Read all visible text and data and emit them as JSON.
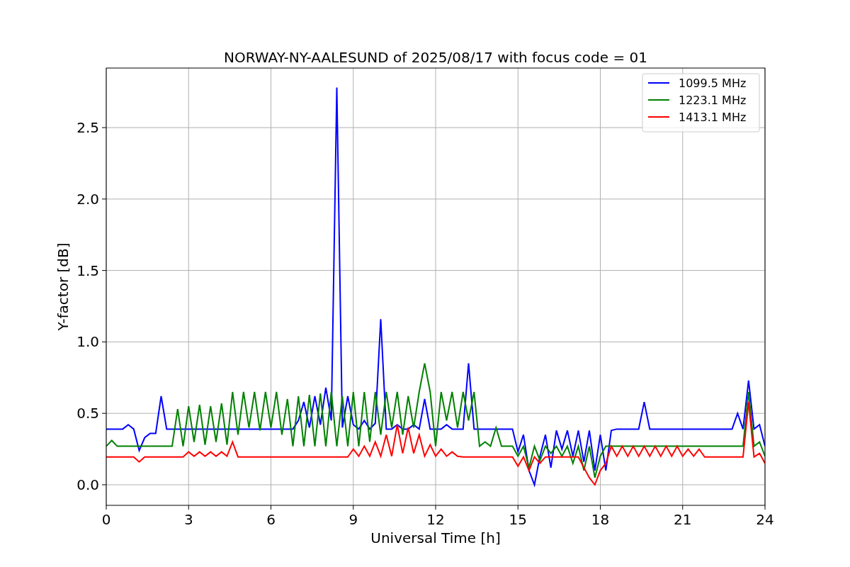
{
  "figure": {
    "chart_data": {
      "type": "line",
      "title": "NORWAY-NY-AALESUND of 2025/08/17 with focus code = 01",
      "xlabel": "Universal Time [h]",
      "ylabel": "Y-factor [dB]",
      "x": [
        0,
        0.2,
        0.4,
        0.6,
        0.8,
        1,
        1.2,
        1.4,
        1.6,
        1.8,
        2,
        2.2,
        2.4,
        2.6,
        2.8,
        3,
        3.2,
        3.4,
        3.6,
        3.8,
        4,
        4.2,
        4.4,
        4.6,
        4.8,
        5,
        5.2,
        5.4,
        5.6,
        5.8,
        6,
        6.2,
        6.4,
        6.6,
        6.8,
        7,
        7.2,
        7.4,
        7.6,
        7.8,
        8,
        8.2,
        8.4,
        8.6,
        8.8,
        9,
        9.2,
        9.4,
        9.6,
        9.8,
        10,
        10.2,
        10.4,
        10.6,
        10.8,
        11,
        11.2,
        11.4,
        11.6,
        11.8,
        12,
        12.2,
        12.4,
        12.6,
        12.8,
        13,
        13.2,
        13.4,
        13.6,
        13.8,
        14,
        14.2,
        14.4,
        14.6,
        14.8,
        15,
        15.2,
        15.4,
        15.6,
        15.8,
        16,
        16.2,
        16.4,
        16.6,
        16.8,
        17,
        17.2,
        17.4,
        17.6,
        17.8,
        18,
        18.2,
        18.4,
        18.6,
        18.8,
        19,
        19.2,
        19.4,
        19.6,
        19.8,
        20,
        20.2,
        20.4,
        20.6,
        20.8,
        21,
        21.2,
        21.4,
        21.6,
        21.8,
        22,
        22.2,
        22.4,
        22.6,
        22.8,
        23,
        23.2,
        23.4,
        23.6,
        23.8,
        24
      ],
      "series": [
        {
          "name": "1099.5 MHz",
          "color": "#0000ff",
          "values": [
            0.39,
            0.39,
            0.39,
            0.39,
            0.42,
            0.39,
            0.24,
            0.33,
            0.36,
            0.36,
            0.62,
            0.39,
            0.39,
            0.39,
            0.39,
            0.39,
            0.39,
            0.39,
            0.39,
            0.39,
            0.39,
            0.39,
            0.39,
            0.39,
            0.39,
            0.39,
            0.39,
            0.39,
            0.39,
            0.39,
            0.39,
            0.39,
            0.39,
            0.39,
            0.39,
            0.45,
            0.58,
            0.4,
            0.62,
            0.42,
            0.68,
            0.45,
            2.78,
            0.4,
            0.62,
            0.42,
            0.39,
            0.45,
            0.39,
            0.43,
            1.16,
            0.39,
            0.39,
            0.42,
            0.39,
            0.39,
            0.42,
            0.39,
            0.6,
            0.39,
            0.39,
            0.39,
            0.42,
            0.39,
            0.39,
            0.39,
            0.85,
            0.39,
            0.39,
            0.39,
            0.39,
            0.39,
            0.39,
            0.39,
            0.39,
            0.23,
            0.35,
            0.1,
            0,
            0.2,
            0.35,
            0.12,
            0.38,
            0.25,
            0.38,
            0.2,
            0.38,
            0.16,
            0.38,
            0.1,
            0.35,
            0.1,
            0.38,
            0.39,
            0.39,
            0.39,
            0.39,
            0.39,
            0.58,
            0.39,
            0.39,
            0.39,
            0.39,
            0.39,
            0.39,
            0.39,
            0.39,
            0.39,
            0.39,
            0.39,
            0.39,
            0.39,
            0.39,
            0.39,
            0.39,
            0.5,
            0.39,
            0.73,
            0.39,
            0.42,
            0.27
          ]
        },
        {
          "name": "1223.1 MHz",
          "color": "#008000",
          "values": [
            0.27,
            0.31,
            0.27,
            0.27,
            0.27,
            0.27,
            0.27,
            0.27,
            0.27,
            0.27,
            0.27,
            0.27,
            0.27,
            0.53,
            0.27,
            0.55,
            0.3,
            0.56,
            0.28,
            0.55,
            0.3,
            0.57,
            0.28,
            0.65,
            0.35,
            0.65,
            0.4,
            0.65,
            0.38,
            0.65,
            0.4,
            0.65,
            0.35,
            0.6,
            0.27,
            0.62,
            0.27,
            0.63,
            0.27,
            0.64,
            0.27,
            0.65,
            0.27,
            0.62,
            0.27,
            0.65,
            0.27,
            0.65,
            0.3,
            0.65,
            0.35,
            0.65,
            0.4,
            0.65,
            0.35,
            0.62,
            0.4,
            0.65,
            0.85,
            0.65,
            0.27,
            0.65,
            0.45,
            0.65,
            0.4,
            0.65,
            0.45,
            0.65,
            0.27,
            0.3,
            0.27,
            0.4,
            0.27,
            0.27,
            0.27,
            0.2,
            0.27,
            0.12,
            0.27,
            0.17,
            0.27,
            0.22,
            0.27,
            0.2,
            0.27,
            0.15,
            0.27,
            0.1,
            0.27,
            0.05,
            0.2,
            0.27,
            0.27,
            0.27,
            0.27,
            0.27,
            0.27,
            0.27,
            0.27,
            0.27,
            0.27,
            0.27,
            0.27,
            0.27,
            0.27,
            0.27,
            0.27,
            0.27,
            0.27,
            0.27,
            0.27,
            0.27,
            0.27,
            0.27,
            0.27,
            0.27,
            0.27,
            0.65,
            0.27,
            0.3,
            0.2
          ]
        },
        {
          "name": "1413.1 MHz",
          "color": "#ff0000",
          "values": [
            0.195,
            0.195,
            0.195,
            0.195,
            0.195,
            0.195,
            0.16,
            0.195,
            0.195,
            0.195,
            0.195,
            0.195,
            0.195,
            0.195,
            0.195,
            0.23,
            0.2,
            0.23,
            0.2,
            0.23,
            0.2,
            0.23,
            0.2,
            0.3,
            0.195,
            0.195,
            0.195,
            0.195,
            0.195,
            0.195,
            0.195,
            0.195,
            0.195,
            0.195,
            0.195,
            0.195,
            0.195,
            0.195,
            0.195,
            0.195,
            0.195,
            0.195,
            0.195,
            0.195,
            0.195,
            0.25,
            0.2,
            0.27,
            0.2,
            0.3,
            0.2,
            0.35,
            0.2,
            0.42,
            0.22,
            0.4,
            0.22,
            0.35,
            0.2,
            0.28,
            0.2,
            0.25,
            0.2,
            0.23,
            0.2,
            0.195,
            0.195,
            0.195,
            0.195,
            0.195,
            0.195,
            0.195,
            0.195,
            0.195,
            0.195,
            0.13,
            0.195,
            0.1,
            0.195,
            0.15,
            0.195,
            0.195,
            0.195,
            0.195,
            0.195,
            0.195,
            0.195,
            0.12,
            0.05,
            0,
            0.1,
            0.15,
            0.27,
            0.2,
            0.27,
            0.2,
            0.27,
            0.2,
            0.27,
            0.2,
            0.27,
            0.2,
            0.27,
            0.2,
            0.27,
            0.2,
            0.25,
            0.2,
            0.25,
            0.195,
            0.195,
            0.195,
            0.195,
            0.195,
            0.195,
            0.195,
            0.195,
            0.58,
            0.195,
            0.22,
            0.15
          ]
        }
      ],
      "grid": true,
      "legend": true,
      "xlim": [
        0,
        24
      ],
      "ylim": [
        -0.144,
        2.917
      ],
      "xticks": [
        0,
        3,
        6,
        9,
        12,
        15,
        18,
        21,
        24
      ],
      "yticks": [
        {
          "value": 0,
          "label": "0.0"
        },
        {
          "value": 0.5,
          "label": "0.5"
        },
        {
          "value": 1,
          "label": "1.0"
        },
        {
          "value": 1.5,
          "label": "1.5"
        },
        {
          "value": 2,
          "label": "2.0"
        },
        {
          "value": 2.5,
          "label": "2.5"
        }
      ]
    }
  }
}
